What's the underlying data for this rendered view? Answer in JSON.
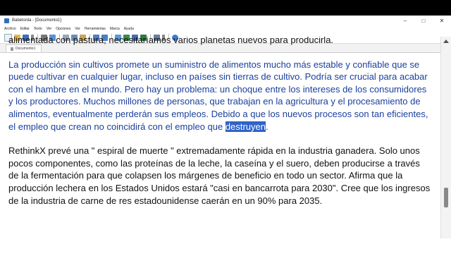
{
  "window": {
    "title": "Babelorda - [Documento1]"
  },
  "menu": [
    "Archivo",
    "Editar",
    "Texto",
    "Ver",
    "Opciones",
    "Ver",
    "Herramientas",
    "Marca",
    "Ayuda"
  ],
  "tab": {
    "label": "Documento1"
  },
  "document": {
    "p0": "alimentada con pastura, necesitaríamos varios planetas nuevos para producirla.",
    "p1_text": "La producción sin cultivos promete un suministro de alimentos mucho más estable y confiable que se puede cultivar en cualquier lugar, incluso en países sin tierras de cultivo. Podría ser crucial para acabar con el hambre en el mundo. Pero hay un problema: un choque entre los intereses de los consumidores y los productores. Muchos millones de personas, que trabajan en la agricultura y el procesamiento de alimentos, eventualmente perderán sus empleos. Debido a que los nuevos procesos son tan eficientes, el empleo que crean no coincidirá con el empleo que ",
    "p1_selected": "destruyen",
    "p1_end": ".",
    "p2": "RethinkX prevé una \" espiral de muerte \" extremadamente rápida en la industria ganadera. Solo unos pocos componentes, como las proteínas de la leche, la caseína y el suero, deben producirse a través de la fermentación para que colapsen los márgenes de beneficio en todo un sector. Afirma que la producción lechera en los Estados Unidos estará \"casi en bancarrota para 2030\". Cree que los ingresos de la industria de carne de res estadounidense caerán en un 90% para 2035."
  },
  "colors": {
    "text": "#111111",
    "highlight_text": "#1a3f9c",
    "selection_bg": "#2f63c9"
  }
}
